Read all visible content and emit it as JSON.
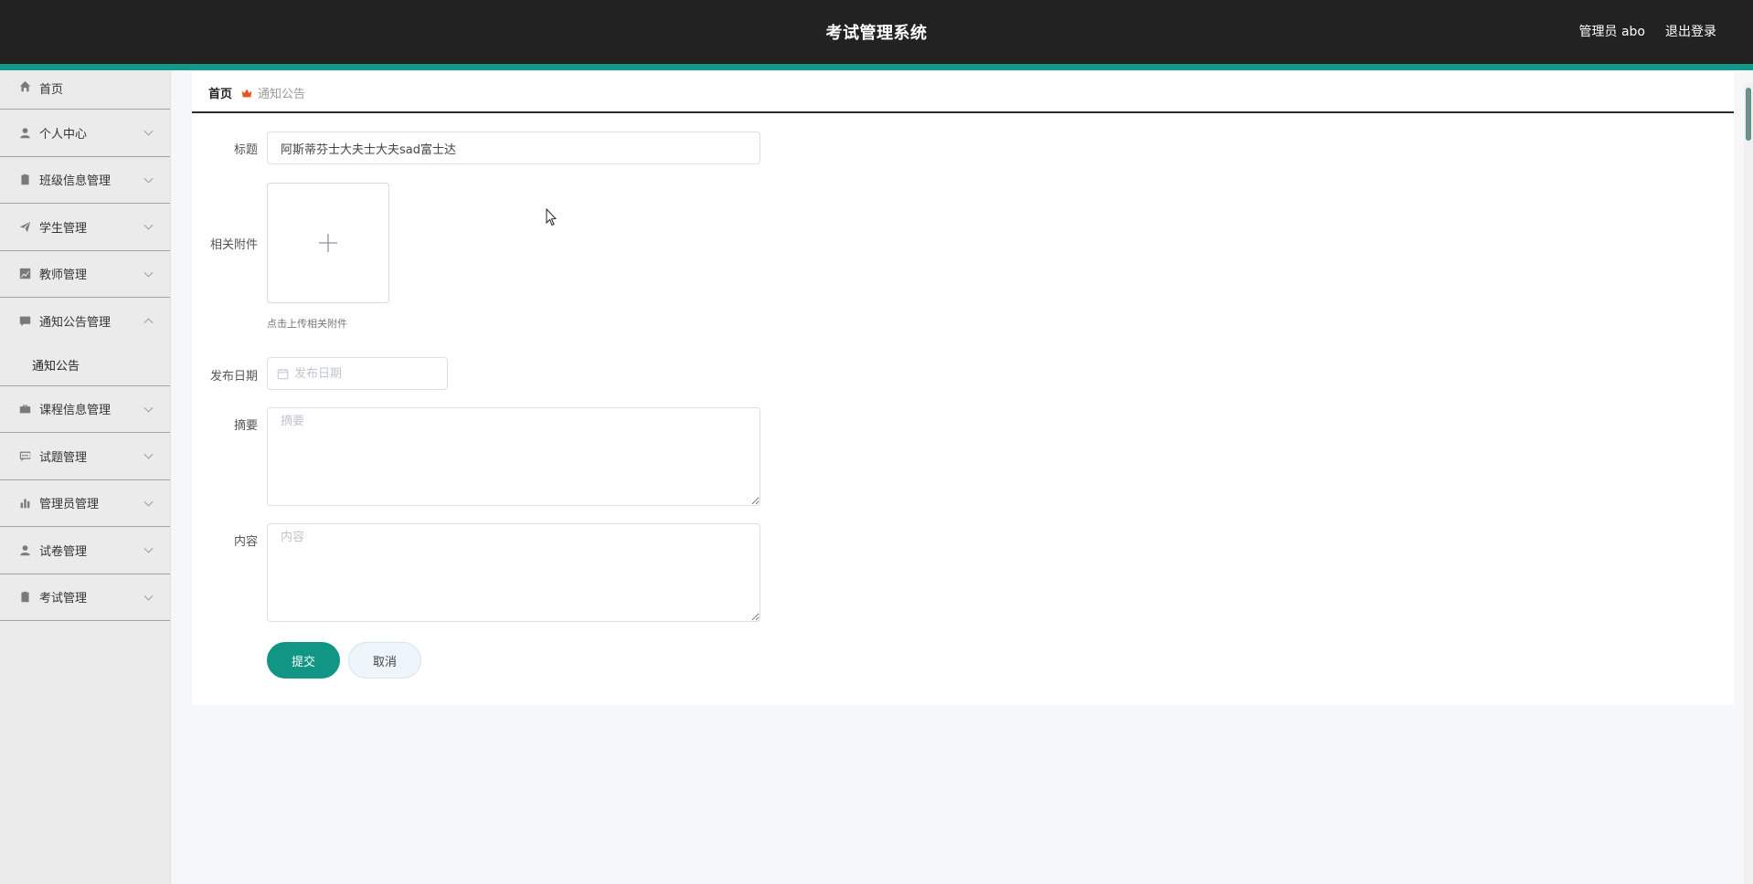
{
  "header": {
    "title": "考试管理系统",
    "user": "管理员 abo",
    "logout": "退出登录",
    "accent_color": "#13988a"
  },
  "sidebar": {
    "items": [
      {
        "label": "首页",
        "icon": "home-icon"
      },
      {
        "label": "个人中心",
        "icon": "user-icon"
      },
      {
        "label": "班级信息管理",
        "icon": "clipboard-icon"
      },
      {
        "label": "学生管理",
        "icon": "paper-plane-icon"
      },
      {
        "label": "教师管理",
        "icon": "line-chart-icon"
      },
      {
        "label": "通知公告管理",
        "icon": "comment-icon",
        "expanded": true,
        "children": [
          {
            "label": "通知公告"
          }
        ]
      },
      {
        "label": "课程信息管理",
        "icon": "briefcase-icon"
      },
      {
        "label": "试题管理",
        "icon": "message-icon"
      },
      {
        "label": "管理员管理",
        "icon": "bar-chart-icon"
      },
      {
        "label": "试卷管理",
        "icon": "user-icon"
      },
      {
        "label": "考试管理",
        "icon": "clipboard-icon"
      }
    ]
  },
  "breadcrumb": {
    "home": "首页",
    "current": "通知公告"
  },
  "form": {
    "title_label": "标题",
    "title_value": "阿斯蒂芬士大夫士大夫sad富士达",
    "attachment_label": "相关附件",
    "upload_hint": "点击上传相关附件",
    "date_label": "发布日期",
    "date_placeholder": "发布日期",
    "summary_label": "摘要",
    "summary_placeholder": "摘要",
    "content_label": "内容",
    "content_placeholder": "内容",
    "submit": "提交",
    "cancel": "取消"
  }
}
